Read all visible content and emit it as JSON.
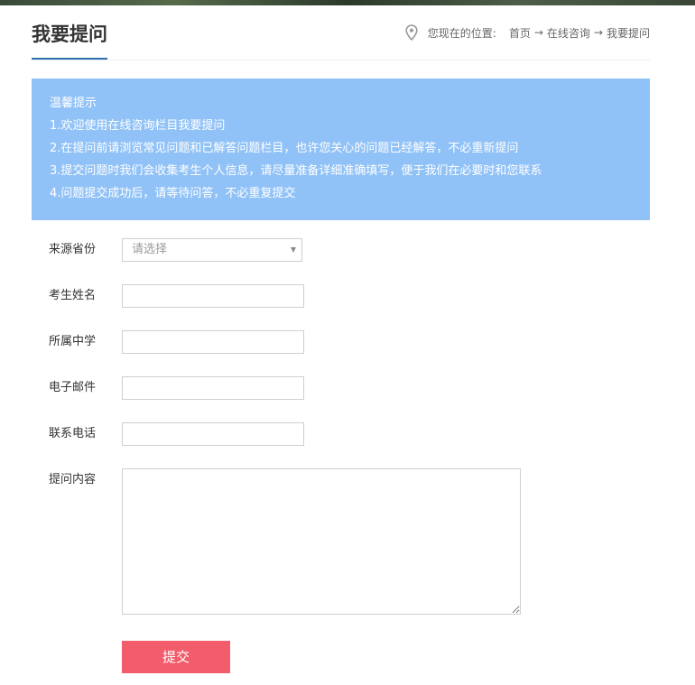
{
  "header": {
    "title": "我要提问",
    "breadcrumb": {
      "prefix": "您现在的位置:",
      "items": [
        "首页",
        "在线咨询",
        "我要提问"
      ],
      "separator": "→"
    }
  },
  "notice": {
    "heading": "温馨提示",
    "lines": [
      "1.欢迎使用在线咨询栏目我要提问",
      "2.在提问前请浏览常见问题和已解答问题栏目，也许您关心的问题已经解答，不必重新提问",
      "3.提交问题时我们会收集考生个人信息，请尽量准备详细准确填写，便于我们在必要时和您联系",
      "4.问题提交成功后，请等待问答，不必重复提交"
    ]
  },
  "form": {
    "province": {
      "label": "来源省份",
      "value": "请选择"
    },
    "name": {
      "label": "考生姓名",
      "value": ""
    },
    "school": {
      "label": "所属中学",
      "value": ""
    },
    "email": {
      "label": "电子邮件",
      "value": ""
    },
    "phone": {
      "label": "联系电话",
      "value": ""
    },
    "content": {
      "label": "提问内容",
      "value": ""
    },
    "submit_label": "提交"
  },
  "colors": {
    "notice_bg": "#91c2f7",
    "title_underline": "#2f6fb3",
    "submit_bg": "#f35c6b"
  },
  "icons": {
    "location": "map-pin-icon",
    "select_caret": "caret-down-icon"
  }
}
